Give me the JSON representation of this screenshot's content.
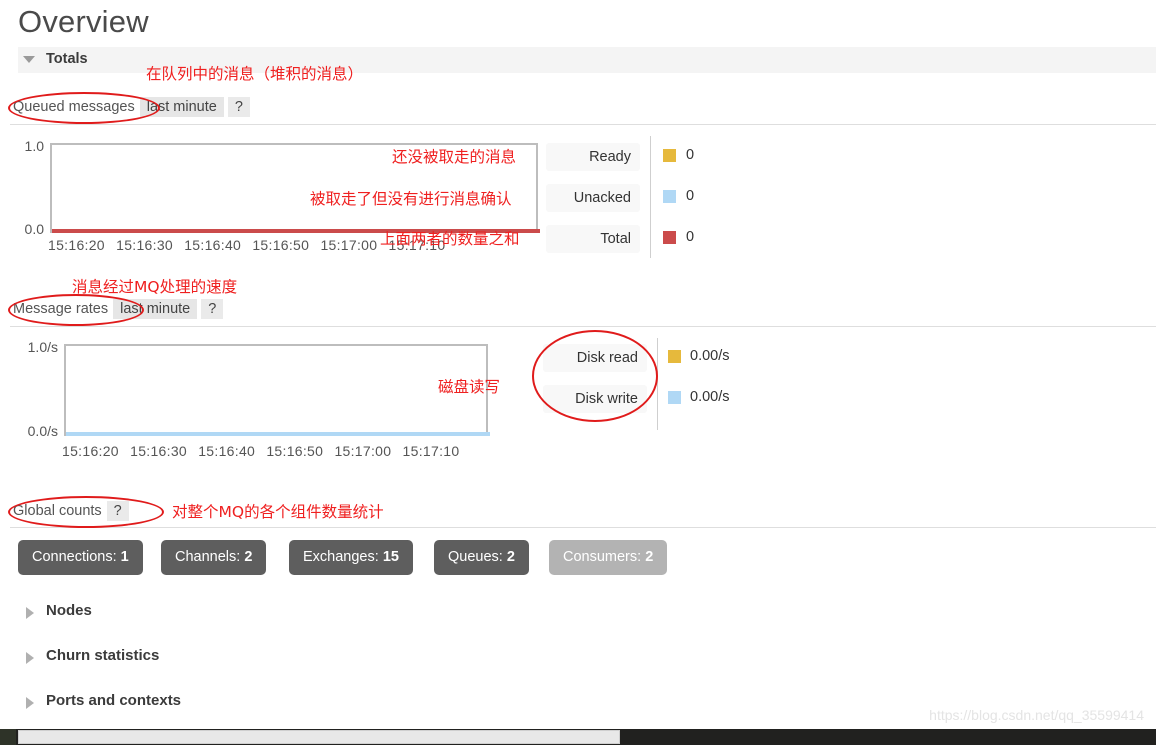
{
  "page": {
    "title": "Overview"
  },
  "totals_section": {
    "label": "Totals",
    "caret_icon": "caret-down-icon"
  },
  "queued_messages": {
    "title": "Queued messages",
    "tab": "last minute",
    "help": "?"
  },
  "message_rates": {
    "title": "Message rates",
    "tab": "last minute",
    "help": "?"
  },
  "global_counts": {
    "title": "Global counts",
    "help": "?",
    "buttons": [
      {
        "label": "Connections:",
        "value": "1",
        "muted": false
      },
      {
        "label": "Channels:",
        "value": "2",
        "muted": false
      },
      {
        "label": "Exchanges:",
        "value": "15",
        "muted": false
      },
      {
        "label": "Queues:",
        "value": "2",
        "muted": false
      },
      {
        "label": "Consumers:",
        "value": "2",
        "muted": true
      }
    ]
  },
  "collapsed_sections": [
    {
      "label": "Nodes",
      "icon": "caret-right-icon"
    },
    {
      "label": "Churn statistics",
      "icon": "caret-right-icon"
    },
    {
      "label": "Ports and contexts",
      "icon": "caret-right-icon"
    }
  ],
  "annotations": [
    {
      "id": "anno-queued",
      "text": "在队列中的消息（堆积的消息）"
    },
    {
      "id": "anno-ready",
      "text": "还没被取走的消息"
    },
    {
      "id": "anno-unacked",
      "text": "被取走了但没有进行消息确认"
    },
    {
      "id": "anno-total",
      "text": "上面两者的数量之和"
    },
    {
      "id": "anno-rates",
      "text": "消息经过MQ处理的速度"
    },
    {
      "id": "anno-disk",
      "text": "磁盘读写"
    },
    {
      "id": "anno-counts",
      "text": "对整个MQ的各个组件数量统计"
    }
  ],
  "watermark": "https://blog.csdn.net/qq_35599414",
  "colors": {
    "ready": "#e6b93c",
    "unacked": "#b0d8f5",
    "total": "#cb4b4b",
    "disk_read": "#e6b93c",
    "disk_write": "#b0d8f5",
    "annotation_red": "#ef2020",
    "button_dark": "#5e5e5e",
    "button_muted": "#b3b3b3"
  },
  "chart_data": [
    {
      "type": "line",
      "title": "Queued messages",
      "subtitle": "last minute",
      "xlabel": "",
      "ylabel": "",
      "ylim": [
        0.0,
        1.0
      ],
      "ytick_labels": [
        "0.0",
        "1.0"
      ],
      "x": [
        "15:16:20",
        "15:16:30",
        "15:16:40",
        "15:16:50",
        "15:17:00",
        "15:17:10"
      ],
      "xtick_labels": [
        "15:16:20",
        "15:16:30",
        "15:16:40",
        "15:16:50",
        "15:17:00",
        "15:17:10"
      ],
      "grid": false,
      "legend_position": "right",
      "series": [
        {
          "name": "Ready",
          "color": "#e6b93c",
          "current": "0",
          "values": [
            0,
            0,
            0,
            0,
            0,
            0
          ]
        },
        {
          "name": "Unacked",
          "color": "#b0d8f5",
          "current": "0",
          "values": [
            0,
            0,
            0,
            0,
            0,
            0
          ]
        },
        {
          "name": "Total",
          "color": "#cb4b4b",
          "current": "0",
          "values": [
            0,
            0,
            0,
            0,
            0,
            0
          ]
        }
      ]
    },
    {
      "type": "line",
      "title": "Message rates",
      "subtitle": "last minute",
      "xlabel": "",
      "ylabel": "",
      "ylim": [
        0.0,
        1.0
      ],
      "ytick_labels": [
        "0.0/s",
        "1.0/s"
      ],
      "x": [
        "15:16:20",
        "15:16:30",
        "15:16:40",
        "15:16:50",
        "15:17:00",
        "15:17:10"
      ],
      "xtick_labels": [
        "15:16:20",
        "15:16:30",
        "15:16:40",
        "15:16:50",
        "15:17:00",
        "15:17:10"
      ],
      "grid": false,
      "legend_position": "right",
      "series": [
        {
          "name": "Disk read",
          "color": "#e6b93c",
          "current": "0.00/s",
          "values": [
            0,
            0,
            0,
            0,
            0,
            0
          ]
        },
        {
          "name": "Disk write",
          "color": "#b0d8f5",
          "current": "0.00/s",
          "values": [
            0,
            0,
            0,
            0,
            0,
            0
          ]
        }
      ]
    }
  ]
}
